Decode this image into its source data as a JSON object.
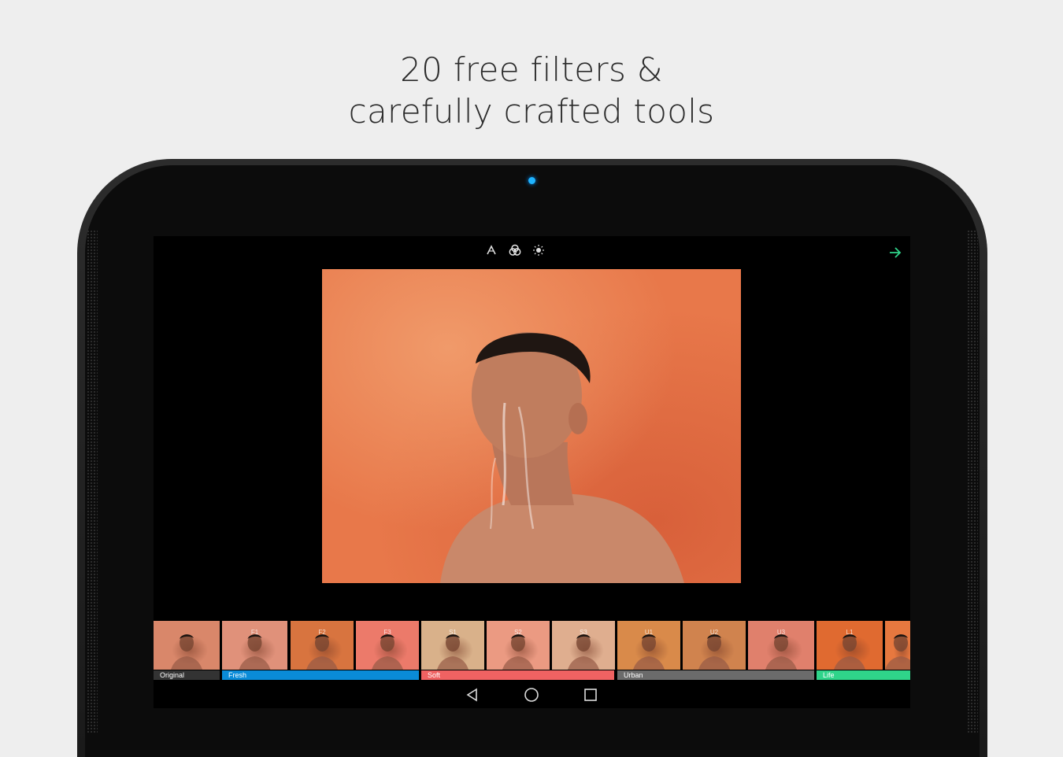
{
  "headline": {
    "line1": "20 free filters &",
    "line2": "carefully crafted tools"
  },
  "editor": {
    "tools": [
      {
        "icon": "auto-enhance-icon"
      },
      {
        "icon": "filters-icon"
      },
      {
        "icon": "brightness-icon"
      }
    ],
    "next_icon": "arrow-right-icon",
    "accent_color": "#2fd48a"
  },
  "filters": {
    "thumbnails": [
      {
        "label": "",
        "tint": "#d9876a"
      },
      {
        "label": "F1",
        "tint": "#e0917a"
      },
      {
        "label": "F2",
        "tint": "#d8743f"
      },
      {
        "label": "F3",
        "tint": "#ec7a6a"
      },
      {
        "label": "S1",
        "tint": "#d9b18a"
      },
      {
        "label": "S2",
        "tint": "#eb9a82"
      },
      {
        "label": "S3",
        "tint": "#dfae8f"
      },
      {
        "label": "U1",
        "tint": "#d98a4a"
      },
      {
        "label": "U2",
        "tint": "#d0834e"
      },
      {
        "label": "U3",
        "tint": "#e0806c"
      },
      {
        "label": "L1",
        "tint": "#e06a30"
      },
      {
        "label": "",
        "tint": "#e7783f"
      }
    ],
    "groups": [
      {
        "label": "Original",
        "color": "#333333"
      },
      {
        "label": "Fresh",
        "color": "#0a8bd8"
      },
      {
        "label": "Soft",
        "color": "#f06262"
      },
      {
        "label": "Urban",
        "color": "#6b6b6b"
      },
      {
        "label": "Life",
        "color": "#2fd48a"
      }
    ]
  },
  "navbar": {
    "buttons": [
      {
        "icon": "back-icon"
      },
      {
        "icon": "home-icon"
      },
      {
        "icon": "recents-icon"
      }
    ]
  },
  "colors": {
    "camera_led": "#1fb4ff",
    "photo_background": "#e8784a"
  }
}
